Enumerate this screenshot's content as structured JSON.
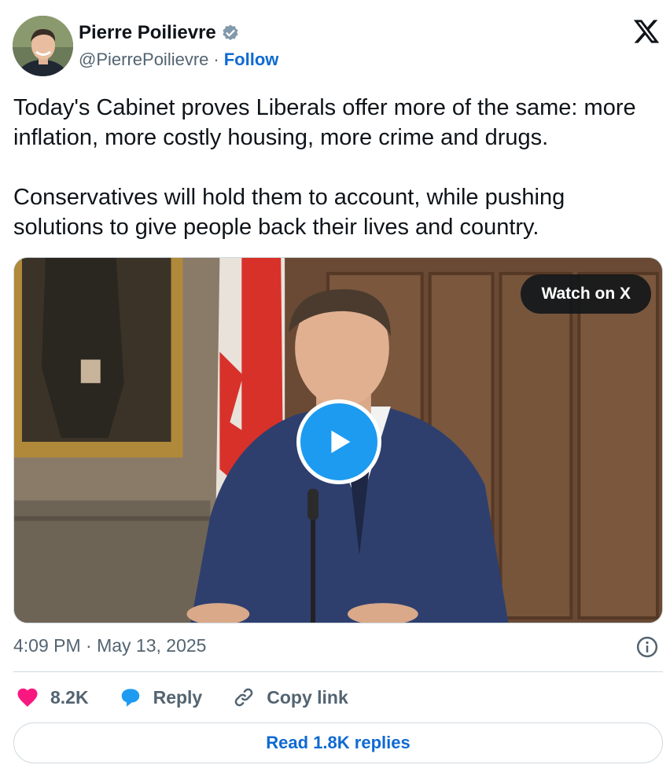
{
  "author": {
    "name": "Pierre Poilievre",
    "handle": "@PierrePoilievre",
    "separator": "·",
    "follow_label": "Follow",
    "verified_color": "#829aab"
  },
  "tweet": {
    "text": "Today's Cabinet proves Liberals offer more of the same: more inflation, more costly housing, more crime and drugs.\n\nConservatives will hold them to account, while pushing solutions to give people back their lives and country."
  },
  "media": {
    "watch_label": "Watch on X",
    "play_color": "#1d9bf0"
  },
  "meta": {
    "timestamp": "4:09 PM · May 13, 2025"
  },
  "actions": {
    "like_count": "8.2K",
    "reply_label": "Reply",
    "copy_label": "Copy link",
    "read_replies_label": "Read 1.8K replies"
  },
  "colors": {
    "like": "#f91880",
    "reply": "#1d9bf0",
    "link": "#0f6ad2",
    "muted": "#536471"
  }
}
